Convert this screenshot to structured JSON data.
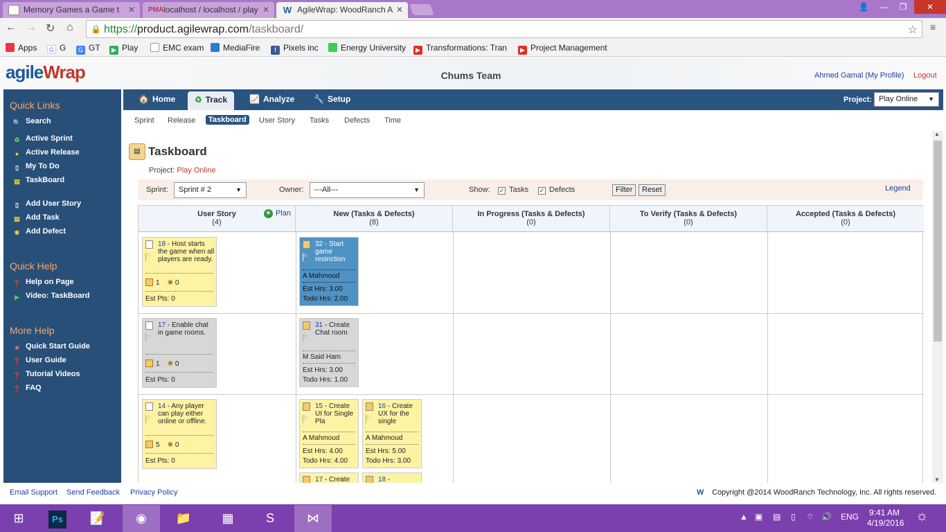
{
  "browser": {
    "tabs": [
      {
        "title": "Memory Games a Game t",
        "favicon": "page-icon"
      },
      {
        "title": "localhost / localhost / play",
        "favicon": "phpmyadmin-icon"
      },
      {
        "title": "AgileWrap: WoodRanch A",
        "favicon": "agilewrap-icon"
      }
    ],
    "url_scheme": "https://",
    "url_host": "product.agilewrap.com",
    "url_path": "/taskboard/",
    "bookmarks": [
      "Apps",
      "G",
      "GT",
      "Play",
      "EMC exam",
      "MediaFire",
      "Pixels inc",
      "Energy University",
      "Transformations: Tran",
      "Project Management"
    ]
  },
  "header": {
    "logo_a": "agile",
    "logo_b": "Wrap",
    "team": "Chums Team",
    "user": "Ahmed Gamal (My Profile)",
    "logout": "Logout"
  },
  "sidebar": {
    "quick_links_title": "Quick Links",
    "quick_links": [
      "Search",
      "Active Sprint",
      "Active Release",
      "My To Do",
      "TaskBoard",
      "Add User Story",
      "Add Task",
      "Add Defect"
    ],
    "quick_help_title": "Quick Help",
    "quick_help": [
      "Help on Page",
      "Video: TaskBoard"
    ],
    "more_help_title": "More Help",
    "more_help": [
      "Quick Start Guide",
      "User Guide",
      "Tutorial Videos",
      "FAQ"
    ]
  },
  "nav": {
    "tabs": [
      "Home",
      "Track",
      "Analyze",
      "Setup"
    ],
    "project_label": "Project:",
    "project_value": "Play Online",
    "sub": [
      "Sprint",
      "Release",
      "Taskboard",
      "User Story",
      "Tasks",
      "Defects",
      "Time"
    ]
  },
  "taskboard": {
    "title": "Taskboard",
    "project_label": "Project:",
    "project_value": "Play Online",
    "sprint_label": "Sprint:",
    "sprint_value": "Sprint # 2",
    "owner_label": "Owner:",
    "owner_value": "---All---",
    "show_label": "Show:",
    "show_tasks": "Tasks",
    "show_defects": "Defects",
    "filter_btn": "Filter",
    "reset_btn": "Reset",
    "legend": "Legend",
    "plan": "Plan",
    "columns": [
      {
        "name": "User Story",
        "count": "(4)"
      },
      {
        "name": "New (Tasks & Defects)",
        "count": "(8)"
      },
      {
        "name": "In Progress (Tasks & Defects)",
        "count": "(0)"
      },
      {
        "name": "To Verify (Tasks & Defects)",
        "count": "(0)"
      },
      {
        "name": "Accepted (Tasks & Defects)",
        "count": "(0)"
      }
    ],
    "stories": [
      {
        "id": "18",
        "text": " - Host starts the game when all players are ready.",
        "tasks": "1",
        "defects": "0",
        "pts": "Est Pts: 0"
      },
      {
        "id": "17",
        "text": " - Enable chat in game rooms.",
        "tasks": "1",
        "defects": "0",
        "pts": "Est Pts: 0"
      },
      {
        "id": "14",
        "text": " - Any player can play either online or offline.",
        "tasks": "5",
        "defects": "0",
        "pts": "Est Pts: 0"
      }
    ],
    "tasks": [
      {
        "id": "32",
        "text": " - Start game restriction",
        "owner": "A Mahmoud",
        "est": "Est Hrs: 3.00",
        "todo": "Todo Hrs: 2.00"
      },
      {
        "id": "31",
        "text": " - Create Chat room",
        "owner": "M Said Ham",
        "est": "Est Hrs: 3.00",
        "todo": "Todo Hrs: 1.00"
      },
      {
        "id": "15",
        "text": " - Create UI for Single Pla",
        "owner": "A Mahmoud",
        "est": "Est Hrs: 4.00",
        "todo": "Todo Hrs: 4.00"
      },
      {
        "id": "16",
        "text": " - Create UX for the single",
        "owner": "A Mahmoud",
        "est": "Est Hrs: 5.00",
        "todo": "Todo Hrs: 3.00"
      },
      {
        "id": "17",
        "text": " - Create",
        "owner": "",
        "est": "",
        "todo": ""
      },
      {
        "id": "18",
        "text": " - \"Network",
        "owner": "",
        "est": "",
        "todo": ""
      }
    ]
  },
  "footer": {
    "links": [
      "Email Support",
      "Send Feedback",
      "Privacy Policy"
    ],
    "copyright": "Copyright @2014 WoodRanch Technology, Inc. All rights reserved."
  },
  "taskbar": {
    "lang": "ENG",
    "time": "9:41 AM",
    "date": "4/19/2016"
  }
}
